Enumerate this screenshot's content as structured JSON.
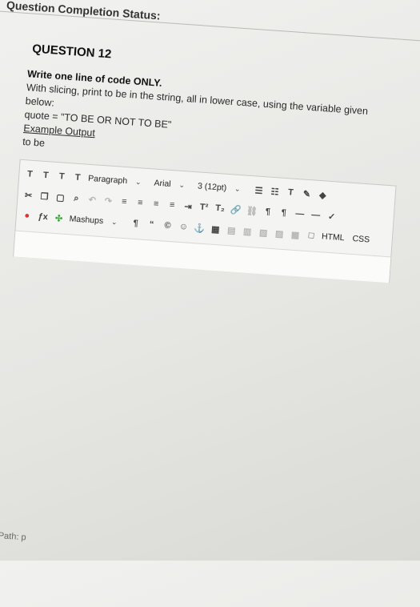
{
  "status": {
    "label": "Question Completion Status:"
  },
  "question": {
    "title": "QUESTION 12",
    "instruction": "Write one line of code ONLY.",
    "line1": "With slicing, print to be in the string, all in lower case, using the variable given below:",
    "line2": "quote = \"TO BE OR NOT TO BE\"",
    "example_label": "Example Output",
    "example_value": "to be"
  },
  "toolbar": {
    "paragraph": "Paragraph",
    "font": "Arial",
    "size": "3 (12pt)",
    "mashups": "Mashups",
    "html": "HTML",
    "css": "CSS"
  },
  "footer": {
    "path": "Path: p"
  },
  "colors": {
    "accent_red": "#d33",
    "accent_green": "#3a3"
  }
}
